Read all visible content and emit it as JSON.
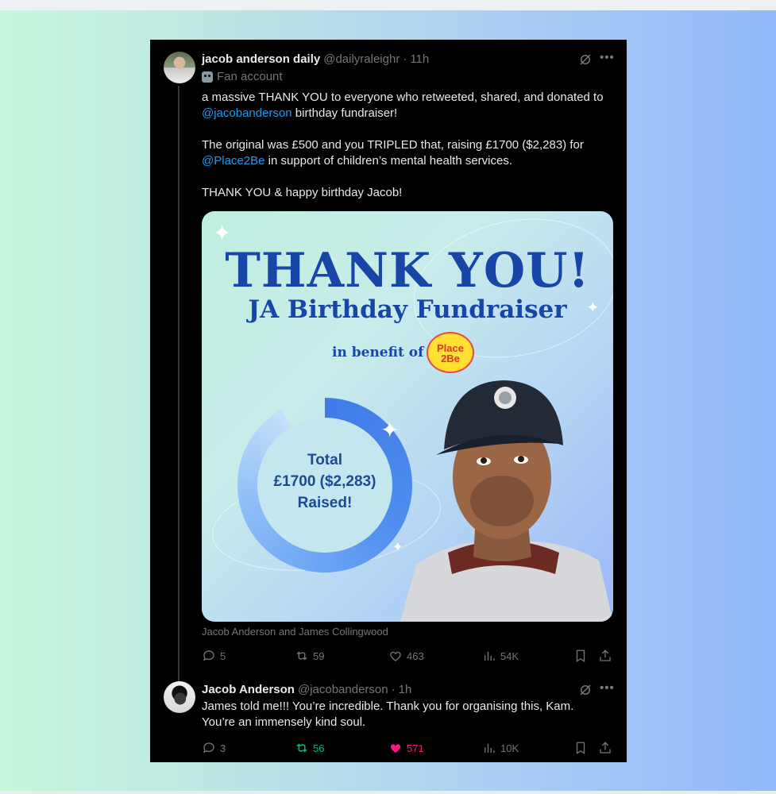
{
  "tweet1": {
    "author_name": "jacob anderson daily",
    "author_handle": "@dailyraleighr",
    "time_sep": "·",
    "time": "11h",
    "label": "Fan account",
    "body": {
      "line1": "a massive THANK YOU to everyone who retweeted, shared, and donated to",
      "mention1": "@jacobanderson",
      "line2_rest": " birthday fundraiser!",
      "line3": "The original was £500 and you TRIPLED that, raising £1700 ($2,283) for",
      "mention2": "@Place2Be",
      "line4_rest": " in support of children’s mental health services.",
      "line5": "THANK YOU & happy birthday Jacob!"
    },
    "media": {
      "title": "THANK YOU!",
      "subtitle": "JA Birthday Fundraiser",
      "benefit_text": "in benefit of",
      "logo_text_line1": "Place",
      "logo_text_line2": "2Be",
      "ring_line1": "Total",
      "ring_line2": "£1700 ($2,283)",
      "ring_line3": "Raised!"
    },
    "caption": "Jacob Anderson and James Collingwood",
    "stats": {
      "replies": "5",
      "reposts": "59",
      "likes": "463",
      "views": "54K"
    }
  },
  "tweet2": {
    "author_name": "Jacob Anderson",
    "author_handle": "@jacobanderson",
    "time_sep": "·",
    "time": "1h",
    "body_line1": "James told me!!! You’re incredible. Thank you for organising this, Kam.",
    "body_line2": "You’re an immensely kind soul.",
    "stats": {
      "replies": "3",
      "reposts": "56",
      "likes": "571",
      "views": "10K"
    }
  },
  "colors": {
    "accent_link": "#1d9bf0",
    "repost_active": "#00ba7c",
    "like_active": "#f91880",
    "muted": "#71767b"
  },
  "icons": [
    "grok-icon",
    "more-icon",
    "fan-account-emoji",
    "reply-icon",
    "repost-icon",
    "like-icon",
    "views-icon",
    "bookmark-icon",
    "share-icon"
  ]
}
